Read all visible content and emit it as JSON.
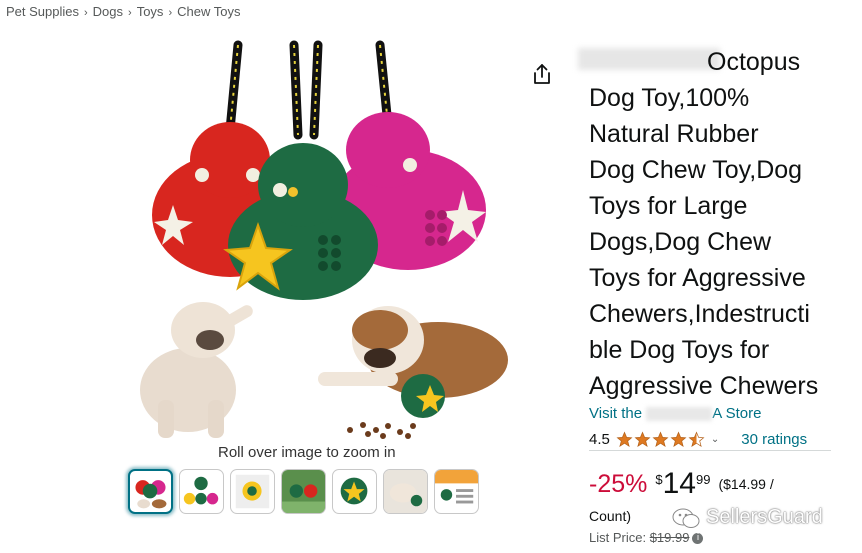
{
  "breadcrumb": [
    "Pet Supplies",
    "Dogs",
    "Toys",
    "Chew Toys"
  ],
  "breadcrumb_separator": "›",
  "gallery": {
    "zoom_hint": "Roll over image to zoom in",
    "thumbnail_count": 7,
    "active_thumbnail": 1
  },
  "product": {
    "title_visible": "Octopus Dog Toy,100% Natural Rubber Dog Chew Toy,Dog Toys for Large Dogs,Dog Chew Toys for Aggressive Chewers,Indestructible Dog Toys for Aggressive Chewers",
    "title_lines": [
      "Octopus",
      "Dog Toy,100%",
      "Natural Rubber",
      "Dog Chew Toy,Dog",
      "Toys for Large",
      "Dogs,Dog Chew",
      "Toys for Aggressive",
      "Chewers,Indestructi",
      "ble Dog Toys for",
      "Aggressive Chewers"
    ],
    "store_prefix": "Visit the",
    "store_suffix": "A Store"
  },
  "rating": {
    "value": "4.5",
    "stars": 4.5,
    "count_label": "30 ratings",
    "star_color": "#de7921"
  },
  "price": {
    "discount": "-25%",
    "currency": "$",
    "whole": "14",
    "fraction": "99",
    "unit_price": "($14.99 /",
    "unit_count": "Count)",
    "list_label": "List Price:",
    "list_value": "$19.99",
    "info_glyph": "i",
    "discount_color": "#cc0c39"
  },
  "icons": {
    "share": "share-icon",
    "chevron": "⌄"
  },
  "watermark": {
    "text": "SellersGuard"
  }
}
